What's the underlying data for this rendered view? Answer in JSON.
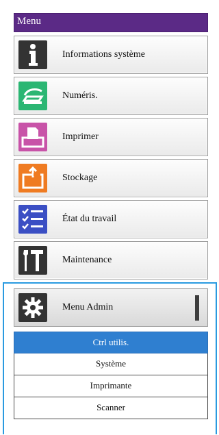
{
  "menu": {
    "title": "Menu",
    "items": [
      {
        "label": "Informations système",
        "icon": "info-icon",
        "color": "#333333"
      },
      {
        "label": "Numéris.",
        "icon": "scan-icon",
        "color": "#2bb673"
      },
      {
        "label": "Imprimer",
        "icon": "print-icon",
        "color": "#c853a8"
      },
      {
        "label": "Stockage",
        "icon": "storage-icon",
        "color": "#ef7b22"
      },
      {
        "label": "État du travail",
        "icon": "job-status-icon",
        "color": "#3b4fc4"
      },
      {
        "label": "Maintenance",
        "icon": "maintenance-icon",
        "color": "#333333"
      }
    ]
  },
  "admin": {
    "label": "Menu Admin",
    "icon": "gear-icon",
    "submenu": [
      {
        "label": "Ctrl utilis.",
        "selected": true
      },
      {
        "label": "Système",
        "selected": false
      },
      {
        "label": "Imprimante",
        "selected": false
      },
      {
        "label": "Scanner",
        "selected": false
      }
    ],
    "highlight_color": "#2f7fd0",
    "frame_color": "#2a9ae0"
  }
}
